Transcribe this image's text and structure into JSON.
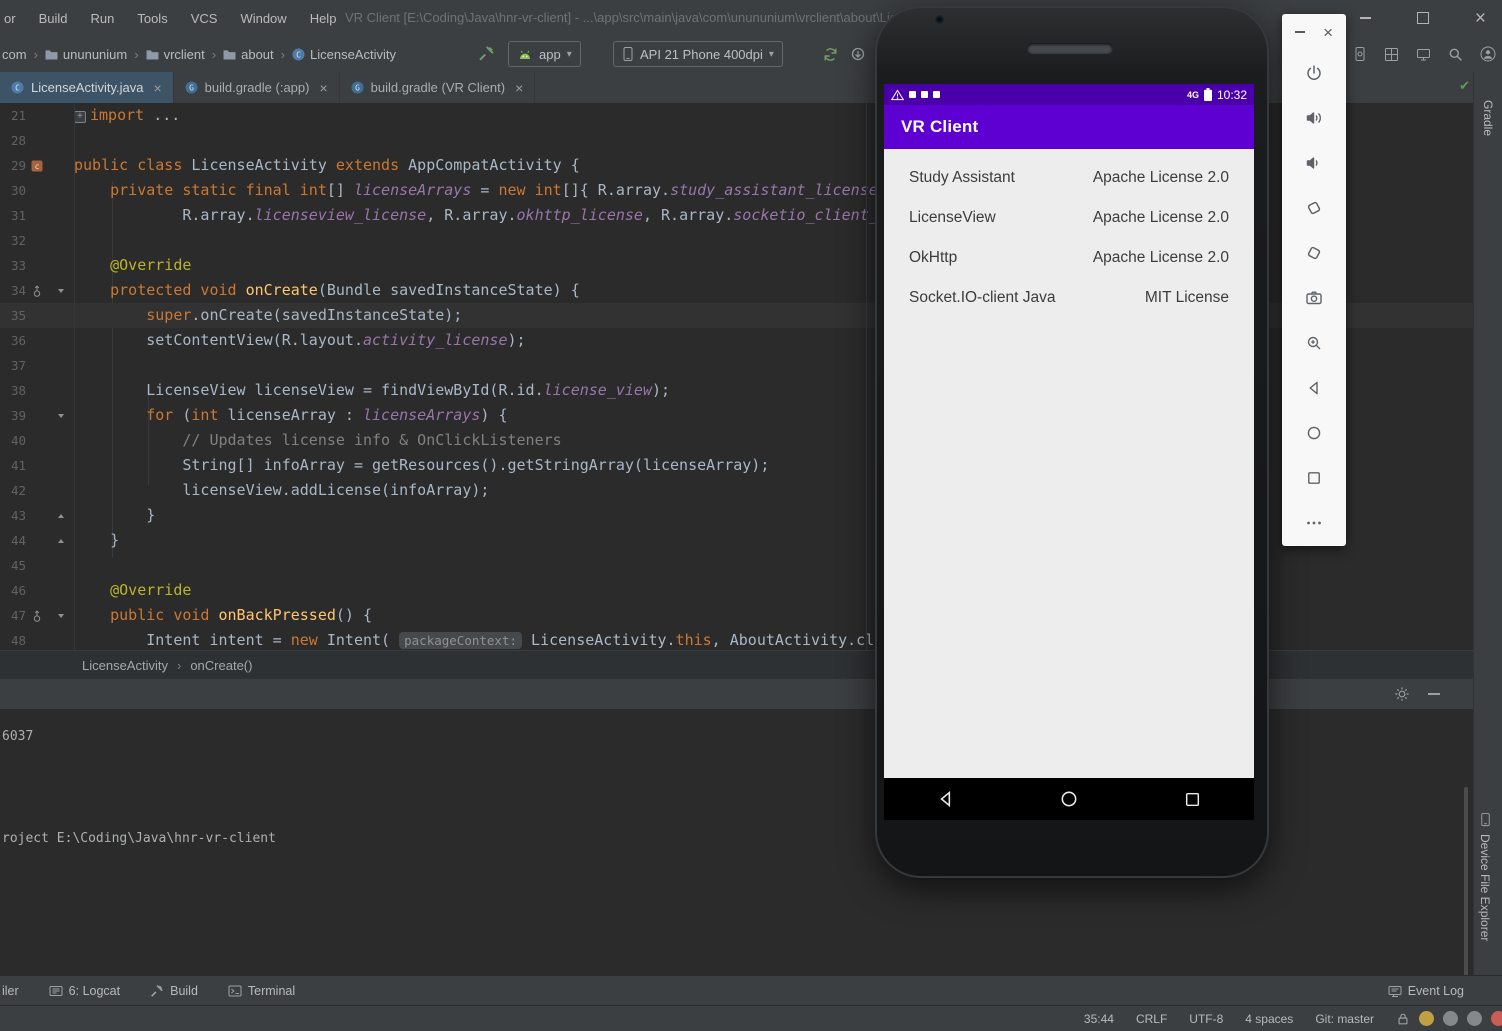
{
  "ide": {
    "menu": [
      "or",
      "Build",
      "Run",
      "Tools",
      "VCS",
      "Window",
      "Help"
    ],
    "title": "VR Client [E:\\Coding\\Java\\hnr-vr-client] - ...\\app\\src\\main\\java\\com\\unununium\\vrclient\\about\\LicenseActivity.java [app] - Android Studio",
    "breadcrumbs": [
      {
        "label": "com",
        "icon": null
      },
      {
        "label": "unununium",
        "icon": "folder-icon"
      },
      {
        "label": "vrclient",
        "icon": "folder-icon"
      },
      {
        "label": "about",
        "icon": "folder-icon"
      },
      {
        "label": "LicenseActivity",
        "icon": "class-icon"
      }
    ],
    "run_config": "app",
    "device": "API 21 Phone 400dpi",
    "tabs": [
      {
        "label": "LicenseActivity.java",
        "icon": "class-icon",
        "active": true
      },
      {
        "label": "build.gradle (:app)",
        "icon": "gradle-icon",
        "active": false
      },
      {
        "label": "build.gradle (VR Client)",
        "icon": "gradle-icon",
        "active": false
      }
    ],
    "editor_breadcrumbs": [
      "LicenseActivity",
      "onCreate()"
    ],
    "console_lines": [
      "6037",
      "roject E:\\Coding\\Java\\hnr-vr-client"
    ],
    "toolwindows_left": [
      {
        "label": "iler",
        "icon": null
      },
      {
        "label": "6: Logcat",
        "icon": "logcat-icon"
      },
      {
        "label": "Build",
        "icon": "hammer-icon"
      },
      {
        "label": "Terminal",
        "icon": "terminal-icon"
      }
    ],
    "toolwindows_right": [
      {
        "label": "Event Log",
        "icon": "eventlog-icon"
      }
    ],
    "status_items": [
      "35:44",
      "CRLF",
      "UTF-8",
      "4 spaces",
      "Git: master"
    ],
    "right_tabs": [
      "Gradle",
      "Device File Explorer"
    ]
  },
  "code": {
    "lines": [
      {
        "num": 21,
        "foldbox": true,
        "segs": [
          [
            "kw",
            "import"
          ],
          [
            "pl",
            " ..."
          ]
        ]
      },
      {
        "num": 28,
        "segs": []
      },
      {
        "num": 29,
        "gutter": "class",
        "segs": [
          [
            "kw",
            "public class"
          ],
          [
            "pl",
            " LicenseActivity "
          ],
          [
            "kw",
            "extends"
          ],
          [
            "pl",
            " AppCompatActivity {"
          ]
        ]
      },
      {
        "num": 30,
        "segs": [
          [
            "pl",
            "    "
          ],
          [
            "kw",
            "private static final int"
          ],
          [
            "pl",
            "[] "
          ],
          [
            "fi",
            "licenseArrays"
          ],
          [
            "pl",
            " = "
          ],
          [
            "kw",
            "new"
          ],
          [
            "pl",
            " "
          ],
          [
            "kw",
            "int"
          ],
          [
            "pl",
            "[]{ R.array."
          ],
          [
            "fi",
            "study_assistant_license"
          ]
        ]
      },
      {
        "num": 31,
        "segs": [
          [
            "pl",
            "            R.array."
          ],
          [
            "fi",
            "licenseview_license"
          ],
          [
            "pl",
            ", R.array."
          ],
          [
            "fi",
            "okhttp_license"
          ],
          [
            "pl",
            ", R.array."
          ],
          [
            "fi",
            "socketio_client_license"
          ]
        ]
      },
      {
        "num": 32,
        "segs": []
      },
      {
        "num": 33,
        "segs": [
          [
            "pl",
            "    "
          ],
          [
            "ann",
            "@Override"
          ]
        ]
      },
      {
        "num": 34,
        "gutter": "override",
        "fold": "down",
        "segs": [
          [
            "pl",
            "    "
          ],
          [
            "kw",
            "protected void"
          ],
          [
            "pl",
            " "
          ],
          [
            "md",
            "onCreate"
          ],
          [
            "pl",
            "(Bundle savedInstanceState) {"
          ]
        ]
      },
      {
        "num": 35,
        "current": true,
        "segs": [
          [
            "pl",
            "        "
          ],
          [
            "kw",
            "super"
          ],
          [
            "pl",
            ".onCreate(savedInstanceState);"
          ]
        ]
      },
      {
        "num": 36,
        "segs": [
          [
            "pl",
            "        setContentView(R.layout."
          ],
          [
            "fi",
            "activity_license"
          ],
          [
            "pl",
            ");"
          ]
        ]
      },
      {
        "num": 37,
        "segs": []
      },
      {
        "num": 38,
        "segs": [
          [
            "pl",
            "        LicenseView licenseView = findViewById(R.id."
          ],
          [
            "fi",
            "license_view"
          ],
          [
            "pl",
            ");"
          ]
        ]
      },
      {
        "num": 39,
        "fold": "down",
        "segs": [
          [
            "pl",
            "        "
          ],
          [
            "kw",
            "for"
          ],
          [
            "pl",
            " ("
          ],
          [
            "kw",
            "int"
          ],
          [
            "pl",
            " licenseArray : "
          ],
          [
            "fi",
            "licenseArrays"
          ],
          [
            "pl",
            ") {"
          ]
        ]
      },
      {
        "num": 40,
        "segs": [
          [
            "pl",
            "            "
          ],
          [
            "cm",
            "// Updates license info & OnClickListeners"
          ]
        ]
      },
      {
        "num": 41,
        "segs": [
          [
            "pl",
            "            String[] infoArray = getResources().getStringArray(licenseArray);"
          ]
        ]
      },
      {
        "num": 42,
        "segs": [
          [
            "pl",
            "            licenseView.addLicense(infoArray);"
          ]
        ]
      },
      {
        "num": 43,
        "fold": "up",
        "segs": [
          [
            "pl",
            "        }"
          ]
        ]
      },
      {
        "num": 44,
        "fold": "up",
        "segs": [
          [
            "pl",
            "    }"
          ]
        ]
      },
      {
        "num": 45,
        "segs": []
      },
      {
        "num": 46,
        "segs": [
          [
            "pl",
            "    "
          ],
          [
            "ann",
            "@Override"
          ]
        ]
      },
      {
        "num": 47,
        "gutter": "override",
        "fold": "down",
        "segs": [
          [
            "pl",
            "    "
          ],
          [
            "kw",
            "public void"
          ],
          [
            "pl",
            " "
          ],
          [
            "md",
            "onBackPressed"
          ],
          [
            "pl",
            "() {"
          ]
        ]
      },
      {
        "num": 48,
        "segs": [
          [
            "pl",
            "        Intent intent = "
          ],
          [
            "kw",
            "new"
          ],
          [
            "pl",
            " Intent( "
          ],
          [
            "hint",
            "packageContext:"
          ],
          [
            "pl",
            " LicenseActivity."
          ],
          [
            "kw",
            "this"
          ],
          [
            "pl",
            ", AboutActivity.cla"
          ]
        ]
      }
    ]
  },
  "emulator": {
    "app_title": "VR Client",
    "time": "10:32",
    "network": "4G",
    "licenses": [
      {
        "name": "Study Assistant",
        "license": "Apache License 2.0"
      },
      {
        "name": "LicenseView",
        "license": "Apache License 2.0"
      },
      {
        "name": "OkHttp",
        "license": "Apache License 2.0"
      },
      {
        "name": "Socket.IO-client Java",
        "license": "MIT License"
      }
    ],
    "toolbar_buttons": [
      "power",
      "volume-up",
      "volume-down",
      "rotate-left",
      "rotate-right",
      "screenshot",
      "zoom",
      "back",
      "home",
      "overview",
      "more"
    ]
  },
  "colors": {
    "appbar_purple": "#5f00d2",
    "statusbar_purple": "#4a00a8",
    "panel_bg": "#3c3f41",
    "editor_bg": "#2b2b2b",
    "keyword_orange": "#cc7832",
    "constant_purple": "#9876aa",
    "annotation_yellow": "#bbb529",
    "method_yellow": "#ffc66b",
    "comment_gray": "#808080"
  }
}
